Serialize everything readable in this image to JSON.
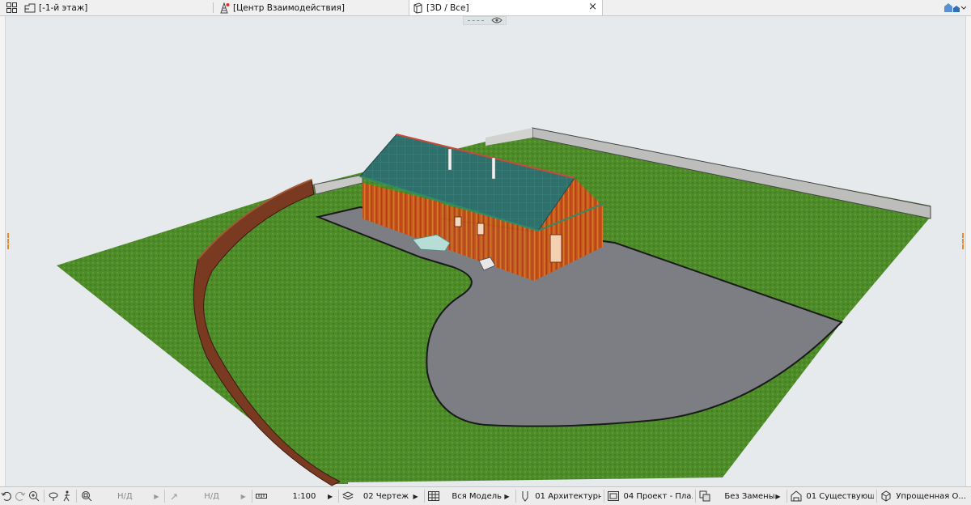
{
  "tabs": [
    {
      "label": "[-1-й этаж]",
      "icon": "floor-plan-icon"
    },
    {
      "label": "[Центр Взаимодействия]",
      "icon": "collaboration-center-icon"
    },
    {
      "label": "[3D / Все]",
      "icon": "3d-view-icon",
      "active": true,
      "close": "×"
    }
  ],
  "status": {
    "scale_na_1": "Н/Д",
    "scale_na_2": "Н/Д",
    "scale": "1:100",
    "layer_combo": "02 Чертеж",
    "model_view": "Вся Модель",
    "pen_set": "01 Архитектурн...",
    "mvo": "04 Проект - Пла...",
    "graphic_override": "Без Замены",
    "renovation": "01 Существующ...",
    "structure_display": "Упрощенная О..."
  },
  "colors": {
    "grass": "#4f8f2a",
    "asphalt": "#7d7e83",
    "fence": "#7a3a22",
    "wall": "#c9501e",
    "roof": "#2e6f6b",
    "background": "#e6eaec"
  }
}
